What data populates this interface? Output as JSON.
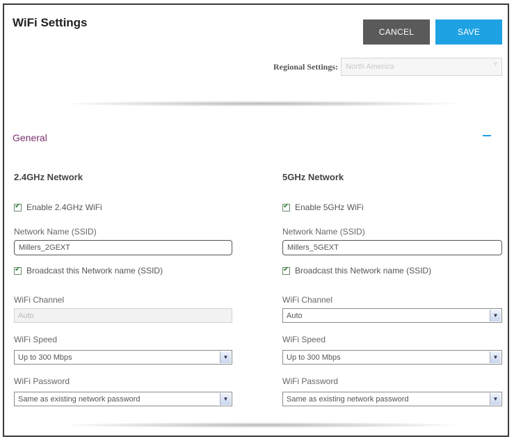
{
  "header": {
    "title": "WiFi Settings",
    "cancel_label": "CANCEL",
    "save_label": "SAVE"
  },
  "regional": {
    "label": "Regional Settings:",
    "value": "North America"
  },
  "section": {
    "title": "General",
    "toggle_symbol": "—"
  },
  "left": {
    "title": "2.4GHz Network",
    "enable_label": "Enable 2.4GHz WiFi",
    "ssid_label": "Network Name (SSID)",
    "ssid_value": "Millers_2GEXT",
    "broadcast_label": "Broadcast this Network name (SSID)",
    "channel_label": "WiFi Channel",
    "channel_value": "Auto",
    "speed_label": "WiFi Speed",
    "speed_value": "Up to 300 Mbps",
    "password_label": "WiFi Password",
    "password_value": "Same as existing network password"
  },
  "right": {
    "title": "5GHz Network",
    "enable_label": "Enable 5GHz WiFi",
    "ssid_label": "Network Name (SSID)",
    "ssid_value": "Millers_5GEXT",
    "broadcast_label": "Broadcast this Network name (SSID)",
    "channel_label": "WiFi Channel",
    "channel_value": "Auto",
    "speed_label": "WiFi Speed",
    "speed_value": "Up to 300 Mbps",
    "password_label": "WiFi Password",
    "password_value": "Same as existing network password"
  },
  "colors": {
    "accent": "#1fa2e3",
    "cancel": "#5a5a5a",
    "section_title": "#7a2f6e",
    "checkmark": "#2e7d32"
  },
  "icons": {
    "checkbox": "checkmark-icon",
    "dropdown": "chevron-down-icon",
    "collapse": "minus-icon"
  }
}
